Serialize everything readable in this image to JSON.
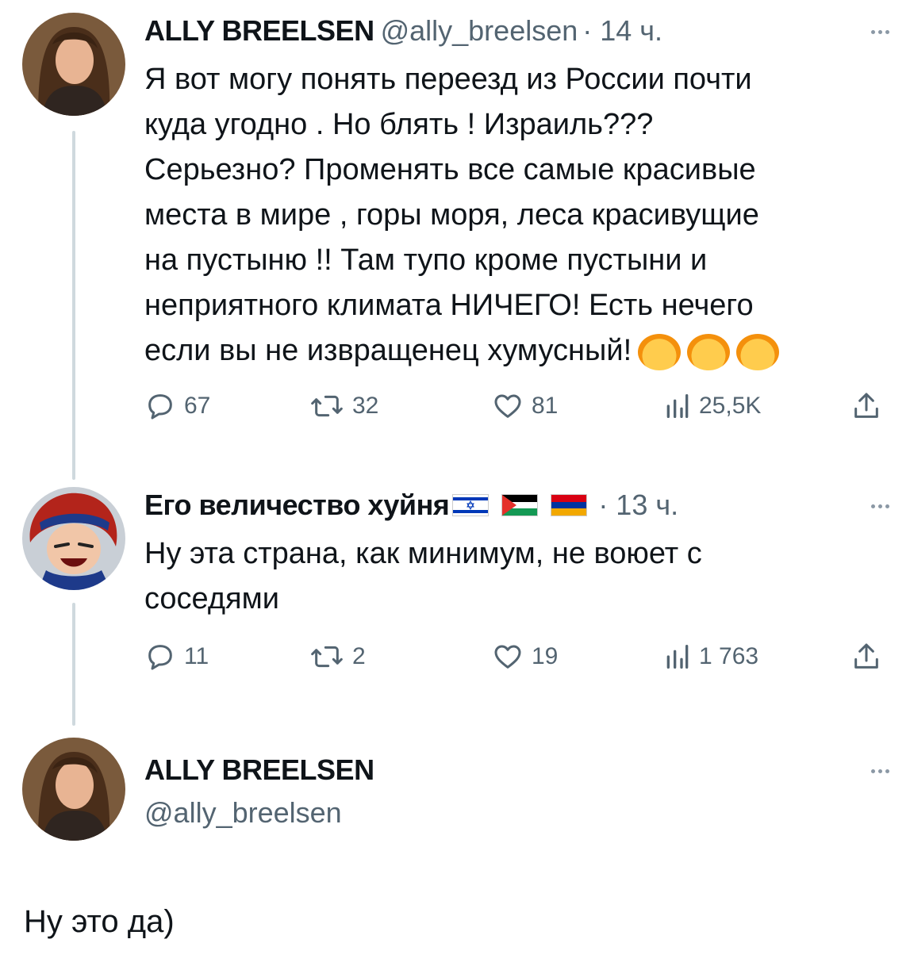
{
  "tweets": [
    {
      "name": "ALLY BREELSEN",
      "handle": "@ally_breelsen",
      "time": "· 14 ч.",
      "lines": [
        "Я вот могу понять переезд из России почти",
        "куда угодно . Но блять ! Израиль???",
        "Серьезно? Променять все самые красивые",
        "места в мире , горы моря, леса красивущие",
        "на пустыню !! Там тупо кроме пустыни и",
        "неприятного климата НИЧЕГО! Есть нечего",
        "если вы не извращенец хумусный!"
      ],
      "emoji": [
        "exploding-head-emoji",
        "exploding-head-emoji",
        "exploding-head-emoji"
      ],
      "stats": {
        "replies": "67",
        "retweets": "32",
        "likes": "81",
        "views": "25,5K"
      }
    },
    {
      "name": "Его величество хуйня",
      "time": "· 13 ч.",
      "flags": [
        "israel-flag",
        "palestine-flag",
        "armenia-flag"
      ],
      "lines": [
        "Ну эта страна, как минимум, не воюет с",
        "соседями"
      ],
      "stats": {
        "replies": "11",
        "retweets": "2",
        "likes": "19",
        "views": "1 763"
      }
    },
    {
      "name": "ALLY BREELSEN",
      "handle": "@ally_breelsen",
      "text": "Ну это да)"
    }
  ],
  "icons": {
    "reply": "reply-icon",
    "retweet": "retweet-icon",
    "like": "heart-icon",
    "views": "views-icon",
    "share": "share-icon",
    "more": "more-icon"
  },
  "colors": {
    "text": "#0f1419",
    "secondary": "#536471",
    "thread_line": "#cfd9de"
  }
}
